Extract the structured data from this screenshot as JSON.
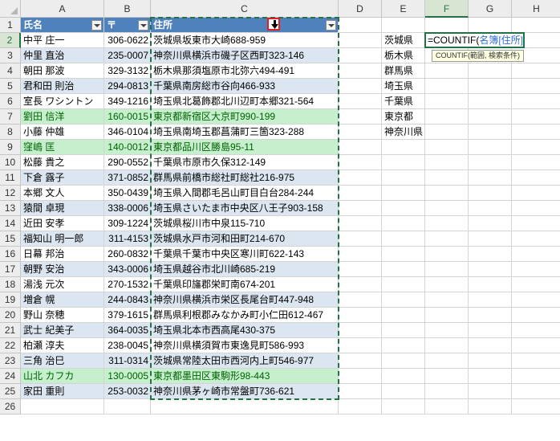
{
  "columns": [
    "A",
    "B",
    "C",
    "D",
    "E",
    "F",
    "G",
    "H"
  ],
  "active_column": "F",
  "active_row": 2,
  "row_numbers": [
    1,
    2,
    3,
    4,
    5,
    6,
    7,
    8,
    9,
    10,
    11,
    12,
    13,
    14,
    15,
    16,
    17,
    18,
    19,
    20,
    21,
    22,
    23,
    24,
    25,
    26
  ],
  "table": {
    "headers": [
      "氏名",
      "〒",
      "住所"
    ],
    "rows": [
      {
        "name": "中平 庄一",
        "zip": "306-0622",
        "addr": "茨城県坂東市大崎688-959",
        "hl": false
      },
      {
        "name": "仲里 直治",
        "zip": "235-0007",
        "addr": "神奈川県横浜市磯子区西町323-146",
        "hl": false
      },
      {
        "name": "朝田 那波",
        "zip": "329-3132",
        "addr": "栃木県那須塩原市北弥六494-491",
        "hl": false
      },
      {
        "name": "君和田 則治",
        "zip": "294-0813",
        "addr": "千葉県南房総市谷向466-933",
        "hl": false
      },
      {
        "name": "室長 ワシントン",
        "zip": "349-1216",
        "addr": "埼玉県北葛飾郡北川辺町本郷321-564",
        "hl": false
      },
      {
        "name": "劉田 信洋",
        "zip": "160-0015",
        "addr": "東京都新宿区大京町990-199",
        "hl": true
      },
      {
        "name": "小藤 仲雄",
        "zip": "346-0104",
        "addr": "埼玉県南埼玉郡菖蒲町三箇323-288",
        "hl": false
      },
      {
        "name": "窪嶋 匡",
        "zip": "140-0012",
        "addr": "東京都品川区勝島95-11",
        "hl": true
      },
      {
        "name": "松藤 貴之",
        "zip": "290-0552",
        "addr": "千葉県市原市久保312-149",
        "hl": false
      },
      {
        "name": "下倉 露子",
        "zip": "371-0852",
        "addr": "群馬県前橋市総社町総社216-975",
        "hl": false
      },
      {
        "name": "本郷 文人",
        "zip": "350-0439",
        "addr": "埼玉県入間郡毛呂山町目白台284-244",
        "hl": false
      },
      {
        "name": "猿間 卓現",
        "zip": "338-0006",
        "addr": "埼玉県さいたま市中央区八王子903-158",
        "hl": false
      },
      {
        "name": "近田 安孝",
        "zip": "309-1224",
        "addr": "茨城県桜川市中泉115-710",
        "hl": false
      },
      {
        "name": "福知山 明一郎",
        "zip": "311-4153",
        "addr": "茨城県水戸市河和田町214-670",
        "hl": false
      },
      {
        "name": "日幕 邦治",
        "zip": "260-0832",
        "addr": "千葉県千葉市中央区寒川町622-143",
        "hl": false
      },
      {
        "name": "朝野 安治",
        "zip": "343-0006",
        "addr": "埼玉県越谷市北川崎685-219",
        "hl": false
      },
      {
        "name": "湯浅 元次",
        "zip": "270-1532",
        "addr": "千葉県印旛郡栄町南674-201",
        "hl": false
      },
      {
        "name": "増倉 幌",
        "zip": "244-0843",
        "addr": "神奈川県横浜市栄区長尾台町447-948",
        "hl": false
      },
      {
        "name": "野山 奈穂",
        "zip": "379-1615",
        "addr": "群馬県利根郡みなかみ町小仁田612-467",
        "hl": false
      },
      {
        "name": "武士 紀美子",
        "zip": "364-0035",
        "addr": "埼玉県北本市西高尾430-375",
        "hl": false
      },
      {
        "name": "柏瀬 淳夫",
        "zip": "238-0045",
        "addr": "神奈川県横須賀市東逸見町586-993",
        "hl": false
      },
      {
        "name": "三角 治巳",
        "zip": "311-0314",
        "addr": "茨城県常陸太田市西河内上町546-977",
        "hl": false
      },
      {
        "name": "山北 カフカ",
        "zip": "130-0005",
        "addr": "東京都墨田区東駒形98-443",
        "hl": true
      },
      {
        "name": "家田 重則",
        "zip": "253-0032",
        "addr": "神奈川県茅ヶ崎市常盤町736-621",
        "hl": false
      }
    ]
  },
  "prefectures": [
    "茨城県",
    "栃木県",
    "群馬県",
    "埼玉県",
    "千葉県",
    "東京都",
    "神奈川県"
  ],
  "formula": {
    "prefix": "=COUNTIF(",
    "ref": "名簿[住所]"
  },
  "tooltip": "COUNTIF(範囲, 検索条件)",
  "colors": {
    "header_blue": "#4f81bd",
    "band": "#dce6f1",
    "green_fill": "#c6efce",
    "green_text": "#006100",
    "excel_green": "#217346"
  }
}
